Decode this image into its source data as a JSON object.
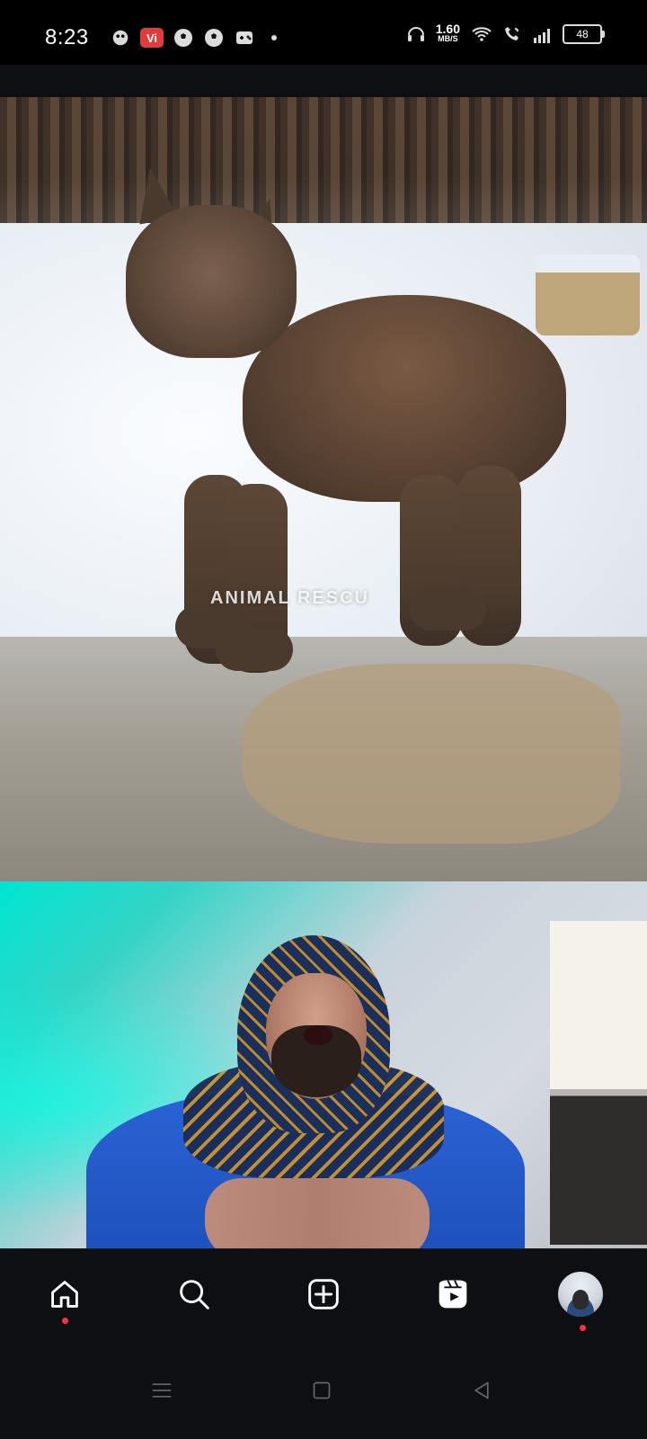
{
  "status_bar": {
    "time": "8:23",
    "vi_badge": "Vi",
    "network_speed_value": "1.60",
    "network_speed_unit": "MB/S",
    "battery": "48"
  },
  "video": {
    "overlay_watermark": "ANIMAL RESCU"
  },
  "bottom_nav": {
    "items": [
      {
        "icon": "home-icon"
      },
      {
        "icon": "search-icon"
      },
      {
        "icon": "create-icon"
      },
      {
        "icon": "reels-icon"
      },
      {
        "icon": "profile-avatar"
      }
    ]
  },
  "system_nav": {
    "items": [
      {
        "icon": "recent-apps-icon"
      },
      {
        "icon": "home-square-icon"
      },
      {
        "icon": "back-triangle-icon"
      }
    ]
  },
  "colors": {
    "background": "#000000",
    "nav_background": "#0e0f13",
    "notification_dot": "#ff3040",
    "vi_badge": "#e23b3b"
  }
}
